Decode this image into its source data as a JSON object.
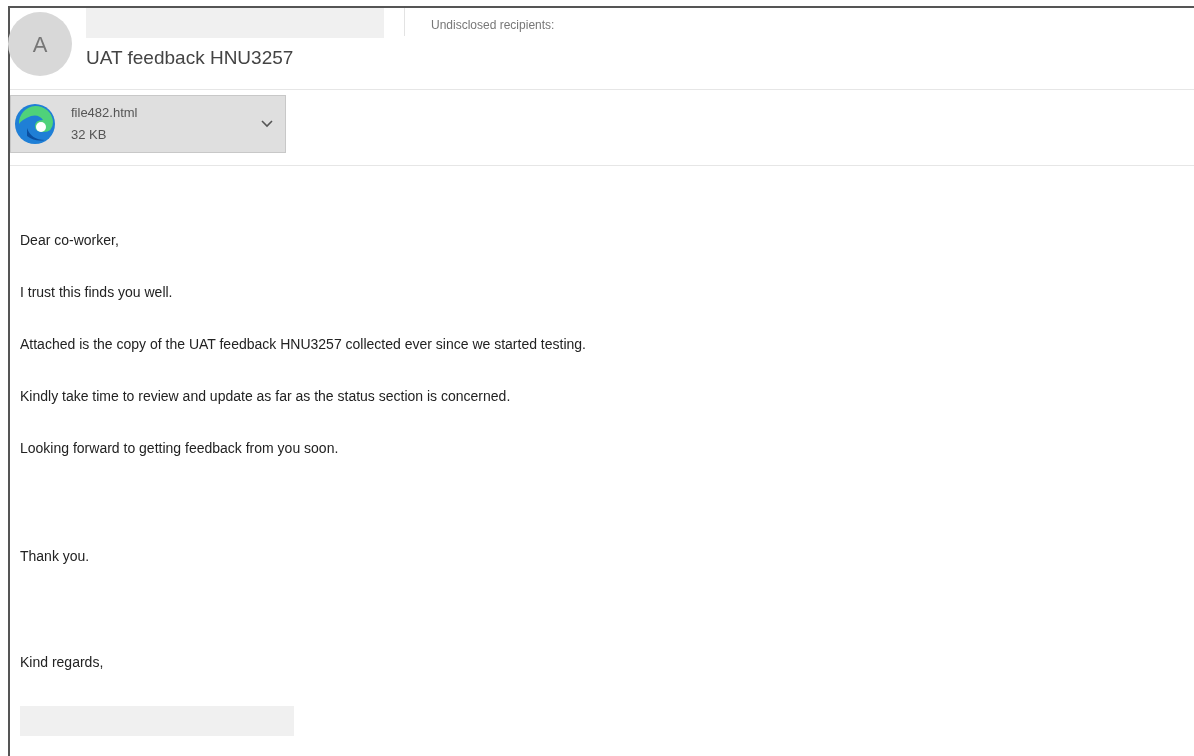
{
  "sender": {
    "avatar_initial": "A"
  },
  "recipients": "Undisclosed recipients:",
  "subject": "UAT feedback HNU3257",
  "attachment": {
    "name": "file482.html",
    "size": "32 KB"
  },
  "body": {
    "greeting": "Dear co-worker,",
    "paragraphs": [
      "I trust this finds you well.",
      "Attached is the copy of the UAT feedback HNU3257 collected ever since we started testing.",
      "Kindly take time to review and update as far as the status section is concerned.",
      "Looking forward to getting feedback from you soon."
    ],
    "closing": "Thank you.",
    "sign_off": "Kind regards,"
  }
}
